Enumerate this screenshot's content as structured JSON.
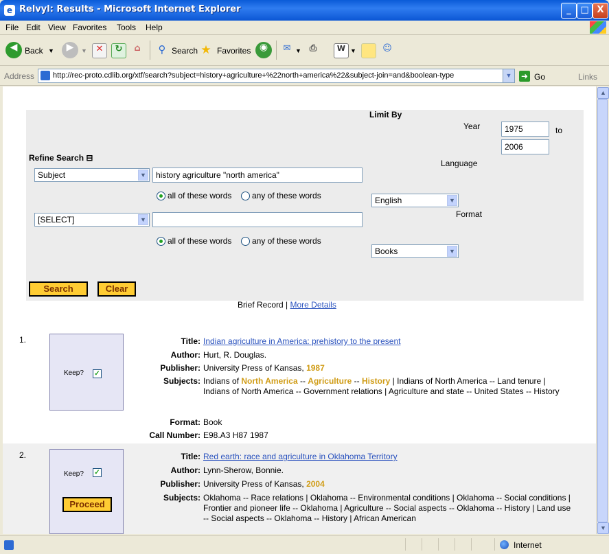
{
  "window": {
    "title": "Relvyl: Results - Microsoft Internet Explorer",
    "minimize": "_",
    "maximize": "□",
    "close": "X"
  },
  "menu": [
    "File",
    "Edit",
    "View",
    "Favorites",
    "Tools",
    "Help"
  ],
  "toolbar": {
    "back": "Back",
    "search": "Search",
    "favorites": "Favorites"
  },
  "address": {
    "label": "Address",
    "url": "http://rec-proto.cdlib.org/xtf/search?subject=history+agriculture+%22north+america%22&subject-join=and&boolean-type",
    "go": "Go",
    "links": "Links"
  },
  "search": {
    "refine_label": "Refine Search ⊟",
    "row1": {
      "field": "Subject",
      "query": "history agriculture \"north america\""
    },
    "row2": {
      "field": "[SELECT]",
      "query": ""
    },
    "all_words": "all of these words",
    "any_words": "any of these words",
    "search_btn": "Search",
    "clear_btn": "Clear"
  },
  "limit": {
    "title": "Limit By",
    "year_label": "Year",
    "year_from": "1975",
    "to_label": "to",
    "year_to": "2006",
    "language_label": "Language",
    "language_value": "English",
    "format_label": "Format",
    "format_value": "Books"
  },
  "view_toggle": {
    "brief": "Brief Record | ",
    "more": "More Details"
  },
  "labels": {
    "title": "Title:",
    "author": "Author:",
    "publisher": "Publisher:",
    "subjects": "Subjects:",
    "format": "Format:",
    "call": "Call Number:",
    "keep": "Keep?",
    "proceed": "Proceed"
  },
  "records": [
    {
      "num": "1.",
      "title": "Indian agriculture in America: prehistory to the present",
      "author": "Hurt, R. Douglas.",
      "publisher": "University Press of Kansas, ",
      "year": "1987",
      "subjects_pre": "Indians of ",
      "subj_hl1": "North America",
      "subj_sep1": " -- ",
      "subj_hl2": "Agriculture",
      "subj_sep2": " -- ",
      "subj_hl3": "History",
      "subjects_rest": " | Indians of North America -- Land tenure | Indians of North America -- Government relations | Agriculture and state -- United States -- History",
      "format": "Book",
      "call_number": "E98.A3 H87 1987"
    },
    {
      "num": "2.",
      "title": "Red earth: race and agriculture in Oklahoma Territory",
      "author": "Lynn-Sherow, Bonnie.",
      "publisher": "University Press of Kansas, ",
      "year": "2004",
      "subjects": "Oklahoma -- Race relations | Oklahoma -- Environmental conditions | Oklahoma -- Social conditions | Frontier and pioneer life -- Oklahoma | Agriculture -- Social aspects -- Oklahoma -- History | Land use -- Social aspects -- Oklahoma -- History | African American"
    }
  ],
  "status": {
    "zone": "Internet"
  }
}
